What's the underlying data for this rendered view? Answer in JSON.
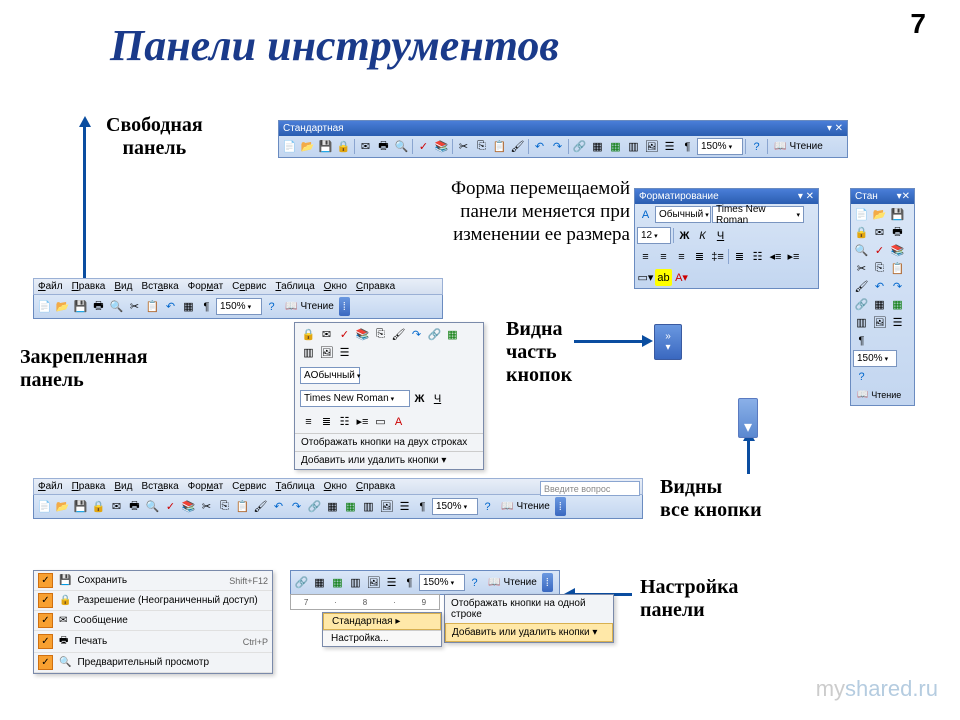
{
  "page_number": "7",
  "title": "Панели инструментов",
  "watermark": {
    "my": "my",
    "shared": "shared.ru"
  },
  "labels": {
    "floating_panel": "Свободная\nпанель",
    "docked_panel": "Закрепленная\nпанель",
    "shape_caption": "Форма перемещаемой\nпанели меняется при\nизменении ее размера",
    "partial_buttons": "Видна\nчасть\nкнопок",
    "all_buttons": "Видны\nвсе кнопки",
    "customize_panel": "Настройка\nпанели"
  },
  "menubar": [
    "Файл",
    "Правка",
    "Вид",
    "Вставка",
    "Формат",
    "Сервис",
    "Таблица",
    "Окно",
    "Справка"
  ],
  "standard_toolbar": {
    "title": "Стандартная",
    "zoom": "150%",
    "read_mode": "Чтение"
  },
  "formatting_toolbar": {
    "title": "Форматирование",
    "style": "Обычный",
    "font": "Times New Roman",
    "size": "12",
    "bold": "Ж",
    "italic": "К",
    "underline": "Ч"
  },
  "narrow_toolbar": {
    "title": "Стан",
    "zoom": "150%",
    "read_mode": "Чтение"
  },
  "overflow_menu": {
    "style": "Обычный",
    "font": "Times New Roman",
    "two_rows": "Отображать кнопки на двух строках",
    "add_remove": "Добавить или удалить кнопки"
  },
  "search_placeholder": "Введите вопрос",
  "customize_menu": {
    "items": [
      {
        "label": "Сохранить",
        "shortcut": "Shift+F12"
      },
      {
        "label": "Разрешение (Неограниченный доступ)",
        "shortcut": ""
      },
      {
        "label": "Сообщение",
        "shortcut": ""
      },
      {
        "label": "Печать",
        "shortcut": "Ctrl+P"
      },
      {
        "label": "Предварительный просмотр",
        "shortcut": ""
      }
    ]
  },
  "bottom_overflow": {
    "one_row": "Отображать кнопки на одной строке",
    "add_remove": "Добавить или удалить кнопки"
  },
  "bottom_submenu": {
    "standard": "Стандартная",
    "customize": "Настройка..."
  },
  "ruler_marks": [
    "7",
    "8",
    "9"
  ]
}
